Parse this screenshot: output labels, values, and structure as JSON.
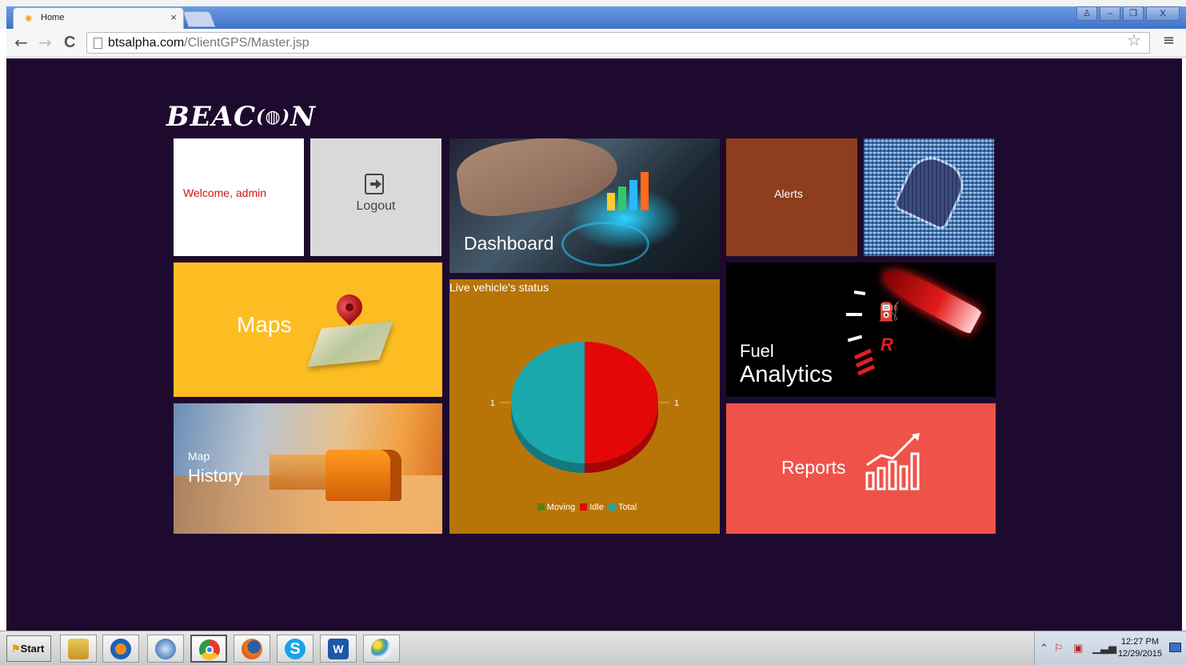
{
  "browser": {
    "tab_title": "Home",
    "tab_close": "×",
    "url_host": "btsalpha.com",
    "url_path": "/ClientGPS/Master.jsp",
    "nav": {
      "back": "←",
      "forward": "→",
      "reload": "C"
    },
    "star": "☆",
    "menu": "≡",
    "window_buttons": [
      "♙",
      "–",
      "❐",
      "X"
    ]
  },
  "app": {
    "logo": "BEAC",
    "logo_wave": "(◍)",
    "logo_tail": "N"
  },
  "tiles": {
    "welcome": "Welcome, admin",
    "logout": "Logout",
    "dashboard": "Dashboard",
    "alerts": "Alerts",
    "maps": "Maps",
    "history_line1": "Map",
    "history_line2": "History",
    "status_title": "Live vehicle's status",
    "fuel_line1": "Fuel",
    "fuel_line2": "Analytics",
    "reports": "Reports"
  },
  "chart_data": {
    "type": "pie",
    "title": "Live vehicle's status",
    "categories": [
      "Moving",
      "Idle",
      "Total"
    ],
    "values": [
      0,
      1,
      1
    ],
    "data_labels": [
      "1",
      "1"
    ],
    "colors": [
      "#5a7f15",
      "#e40707",
      "#1aa8ad"
    ],
    "legend_position": "bottom"
  },
  "taskbar": {
    "start_label": "Start",
    "apps": [
      "file-explorer-icon",
      "media-player-icon",
      "thunderbird-icon",
      "chrome-icon",
      "firefox-icon",
      "skype-icon",
      "word-icon",
      "paint-icon"
    ],
    "time": "12:27 PM",
    "date": "12/29/2015"
  }
}
